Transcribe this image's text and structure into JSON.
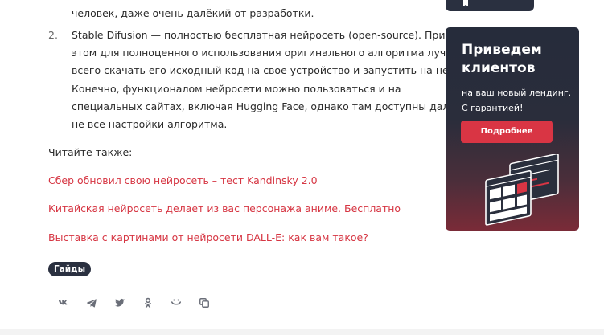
{
  "article": {
    "cut_line": "человек, даже очень далёкий от разработки.",
    "list_item": {
      "number": "2.",
      "lines": [
        "Stable Difusion — полностью бесплатная нейросеть (open-source). При",
        "этом для полноценного использования оригинального алгоритма лучше",
        "всего скачать его исходный код на свое устройство и запустить на нем.",
        "Конечно, функционалом нейросети можно пользоваться и на",
        "специальных сайтах, включая Hugging Face, однако там доступны далеко",
        "не все настройки алгоритма."
      ]
    },
    "read_also": "Читайте также:",
    "links": [
      "Сбер обновил свою нейросеть – тест Kandinsky 2.0",
      "Китайская нейросеть делает из вас персонажа аниме. Бесплатно",
      "Выставка с картинами от нейросети DALL-E: как вам такое?"
    ],
    "tag": "Гайды",
    "share_icons": [
      "vk-icon",
      "telegram-icon",
      "twitter-icon",
      "odnoklassniki-icon",
      "yandex-zen-icon",
      "copy-link-icon"
    ]
  },
  "sidebar": {
    "banner": {
      "title": "Приведем клиентов",
      "subtitle": "на ваш новый лендинг. С гарантией!",
      "button_label": "Подробнее"
    }
  },
  "colors": {
    "link": "#d63542",
    "dark": "#2a3040",
    "accent": "#d93544"
  }
}
